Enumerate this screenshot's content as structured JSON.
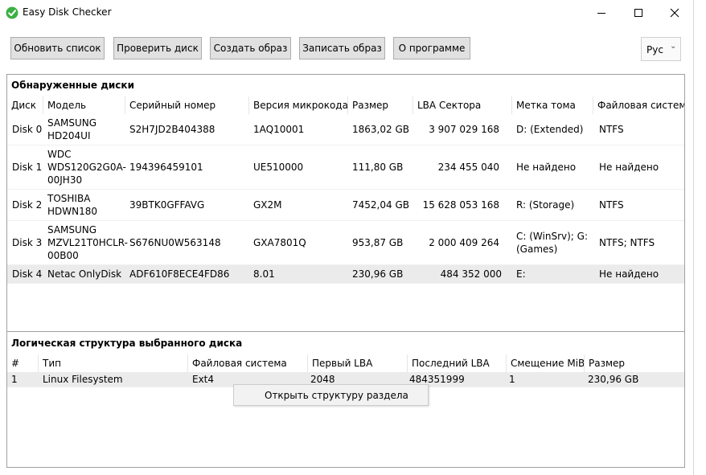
{
  "window": {
    "title": "Easy Disk Checker"
  },
  "toolbar": {
    "refresh": "Обновить список",
    "check": "Проверить диск",
    "create_image": "Создать образ",
    "write_image": "Записать образ",
    "about": "О программе",
    "language": "Рус"
  },
  "disks": {
    "title": "Обнаруженные диски",
    "columns": [
      "Диск",
      "Модель",
      "Серийный номер",
      "Версия микрокода",
      "Размер",
      "LBA Сектора",
      "Метка тома",
      "Файловая система"
    ],
    "rows": [
      [
        "Disk 0",
        "SAMSUNG HD204UI",
        "S2H7JD2B404388",
        "1AQ10001",
        "1863,02 GB",
        "3 907 029 168",
        "D: (Extended)",
        "NTFS"
      ],
      [
        "Disk 1",
        "WDC WDS120G2G0A-00JH30",
        "194396459101",
        "UE510000",
        "111,80 GB",
        "234 455 040",
        "Не найдено",
        "Не найдено"
      ],
      [
        "Disk 2",
        "TOSHIBA HDWN180",
        "39BTK0GFFAVG",
        "GX2M",
        "7452,04 GB",
        "15 628 053 168",
        "R: (Storage)",
        "NTFS"
      ],
      [
        "Disk 3",
        "SAMSUNG MZVL21T0HCLR-00B00",
        "S676NU0W563148",
        "GXA7801Q",
        "953,87 GB",
        "2 000 409 264",
        "C: (WinSrv); G: (Games)",
        "NTFS; NTFS"
      ],
      [
        "Disk 4",
        "Netac OnlyDisk",
        "ADF610F8ECE4FD86",
        "8.01",
        "230,96 GB",
        "484 352 000",
        "E:",
        "Не найдено"
      ]
    ],
    "selected_row": 4
  },
  "partitions": {
    "title": "Логическая структура выбранного диска",
    "columns": [
      "#",
      "Тип",
      "Файловая система",
      "Первый LBA",
      "Последний LBA",
      "Смещение MiB",
      "Размер"
    ],
    "rows": [
      [
        "1",
        "Linux Filesystem",
        "Ext4",
        "2048",
        "484351999",
        "1",
        "230,96 GB"
      ]
    ]
  },
  "context_menu": {
    "open_structure": "Открыть структуру раздела"
  }
}
